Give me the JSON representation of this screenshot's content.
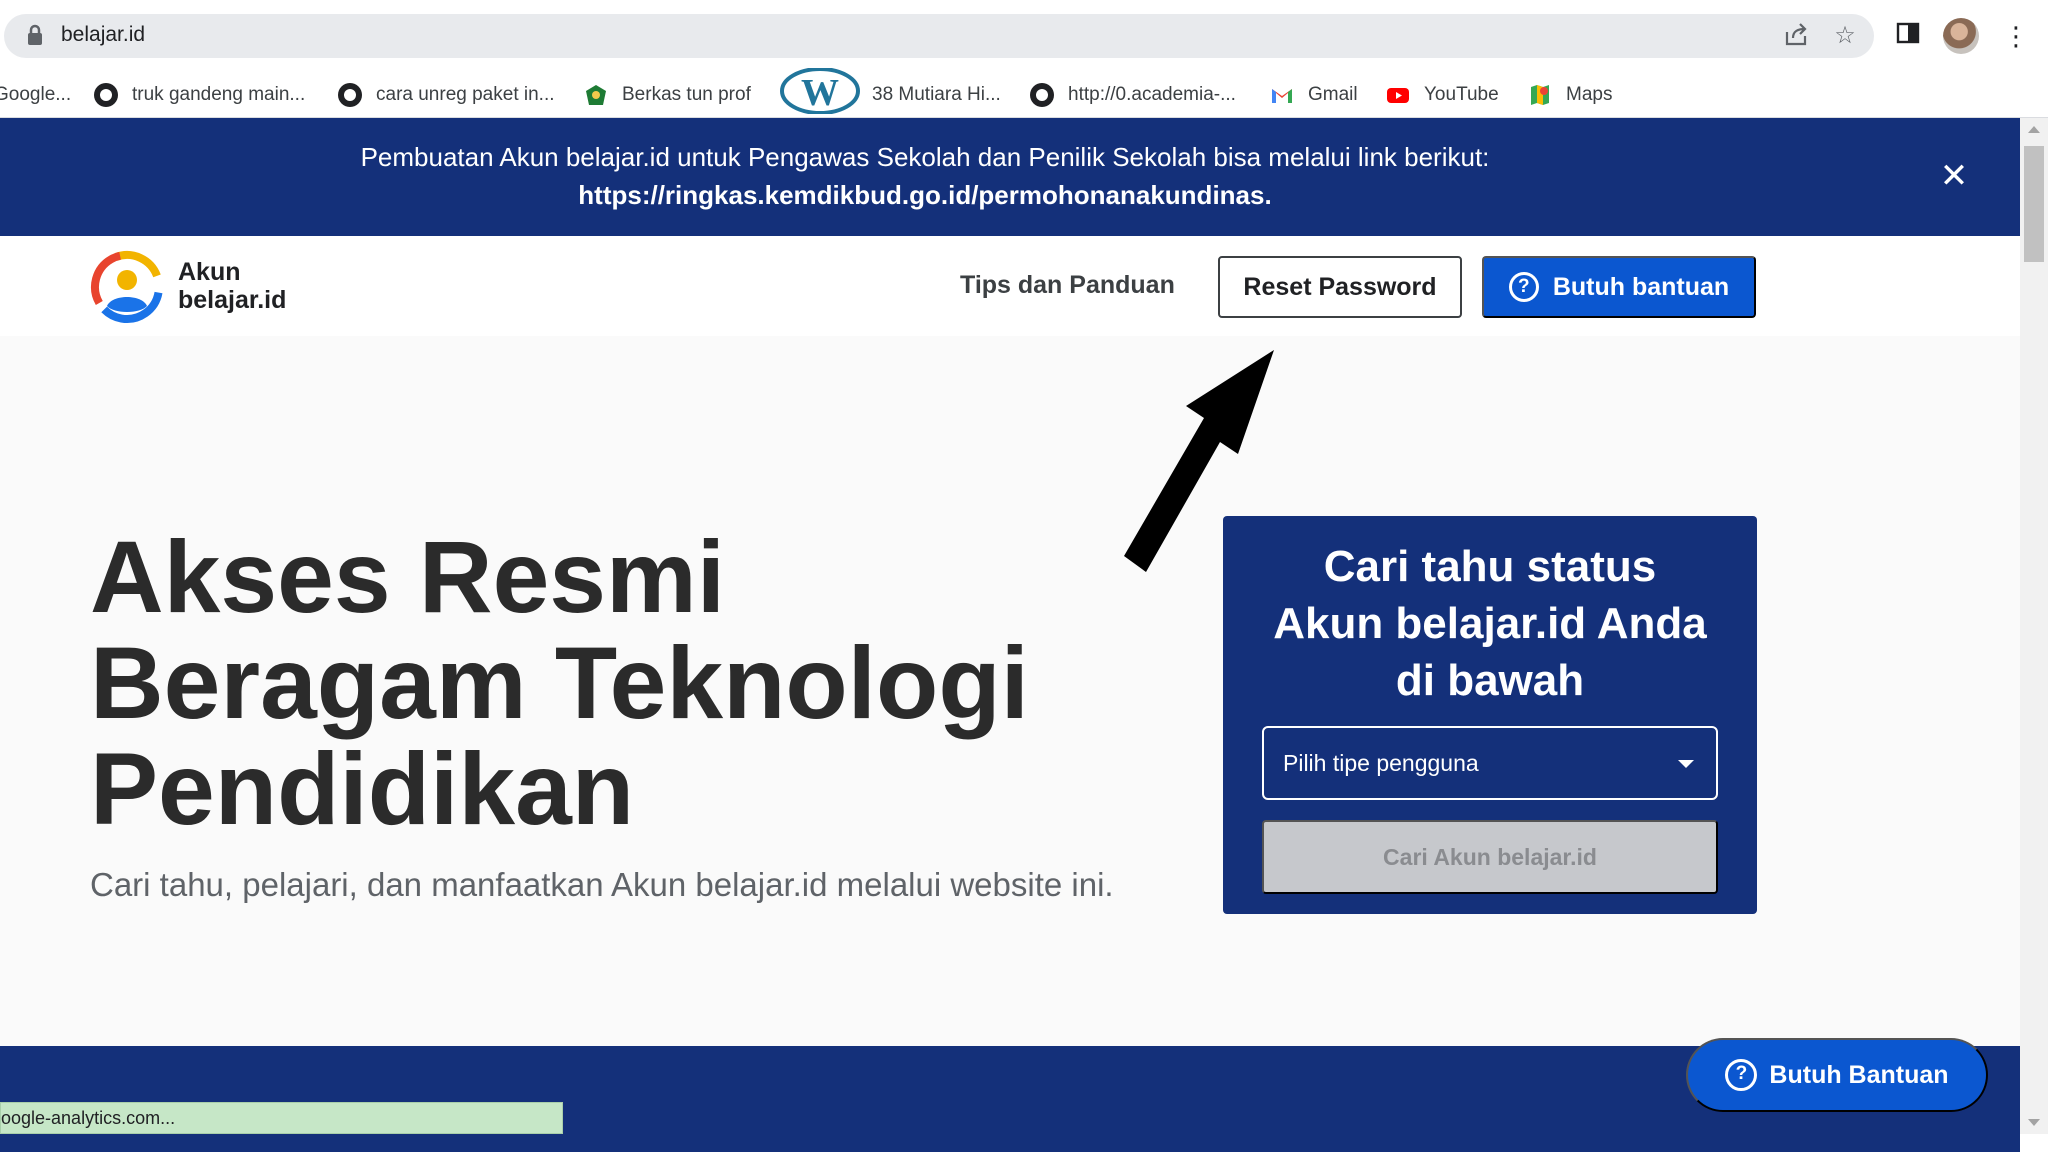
{
  "browser": {
    "url": "belajar.id",
    "icons": [
      "lock-icon",
      "share-icon",
      "star-icon",
      "side-panel-icon",
      "profile-avatar",
      "menu-icon"
    ]
  },
  "bookmarks": [
    {
      "label": "Google...",
      "icon": "google-icon"
    },
    {
      "label": "truk gandeng main...",
      "icon": "globe-icon"
    },
    {
      "label": "cara unreg paket in...",
      "icon": "globe-icon"
    },
    {
      "label": "Berkas tun prof",
      "icon": "gov-shield-icon"
    },
    {
      "label": "38 Mutiara Hi...",
      "icon": "wordpress-icon"
    },
    {
      "label": "http://0.academia-...",
      "icon": "globe-icon"
    },
    {
      "label": "Gmail",
      "icon": "gmail-icon"
    },
    {
      "label": "YouTube",
      "icon": "youtube-icon"
    },
    {
      "label": "Maps",
      "icon": "maps-icon"
    }
  ],
  "announcement": {
    "line1": "Pembuatan Akun belajar.id untuk Pengawas Sekolah dan Penilik Sekolah bisa melalui link berikut:",
    "link": "https://ringkas.kemdikbud.go.id/permohonanakundinas",
    "close": "✕"
  },
  "header": {
    "brand_line1": "Akun",
    "brand_line2": "belajar.id",
    "nav_tips": "Tips dan Panduan",
    "reset_label": "Reset Password",
    "help_label": "Butuh bantuan"
  },
  "hero": {
    "title_line1": "Akses Resmi",
    "title_line2": "Beragam Teknologi",
    "title_line3": "Pendidikan",
    "subtitle": "Cari tahu, pelajari, dan manfaatkan Akun belajar.id melalui website ini."
  },
  "status_card": {
    "title_line1": "Cari tahu status",
    "title_line2": "Akun belajar.id Anda",
    "title_line3": "di bawah",
    "select_placeholder": "Pilih tipe pengguna",
    "search_button": "Cari Akun belajar.id"
  },
  "floating_help": "Butuh Bantuan",
  "status_bar": "oogle-analytics.com...",
  "colors": {
    "navy": "#14307a",
    "primary_blue": "#0b57d0",
    "disabled_gray": "#c6c8cc"
  }
}
